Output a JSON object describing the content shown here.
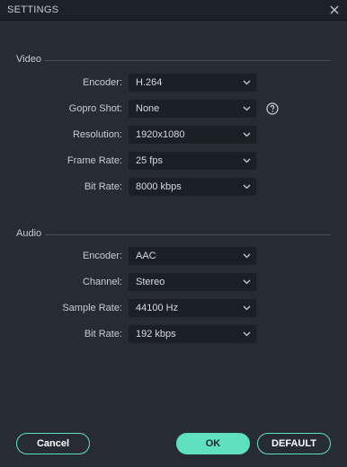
{
  "dialog": {
    "title": "SETTINGS"
  },
  "video": {
    "section_title": "Video",
    "rows": [
      {
        "label": "Encoder:",
        "value": "H.264"
      },
      {
        "label": "Gopro Shot:",
        "value": "None"
      },
      {
        "label": "Resolution:",
        "value": "1920x1080"
      },
      {
        "label": "Frame Rate:",
        "value": "25 fps"
      },
      {
        "label": "Bit Rate:",
        "value": "8000 kbps"
      }
    ]
  },
  "audio": {
    "section_title": "Audio",
    "rows": [
      {
        "label": "Encoder:",
        "value": "AAC"
      },
      {
        "label": "Channel:",
        "value": "Stereo"
      },
      {
        "label": "Sample Rate:",
        "value": "44100 Hz"
      },
      {
        "label": "Bit Rate:",
        "value": "192 kbps"
      }
    ]
  },
  "buttons": {
    "cancel": "Cancel",
    "ok": "OK",
    "default": "DEFAULT"
  },
  "colors": {
    "accent": "#5fe0c0",
    "background": "#262b34",
    "field": "#1b1f26"
  },
  "icons": {
    "close": "close-icon",
    "help": "help-icon",
    "dropdown": "chevron-down-icon"
  }
}
